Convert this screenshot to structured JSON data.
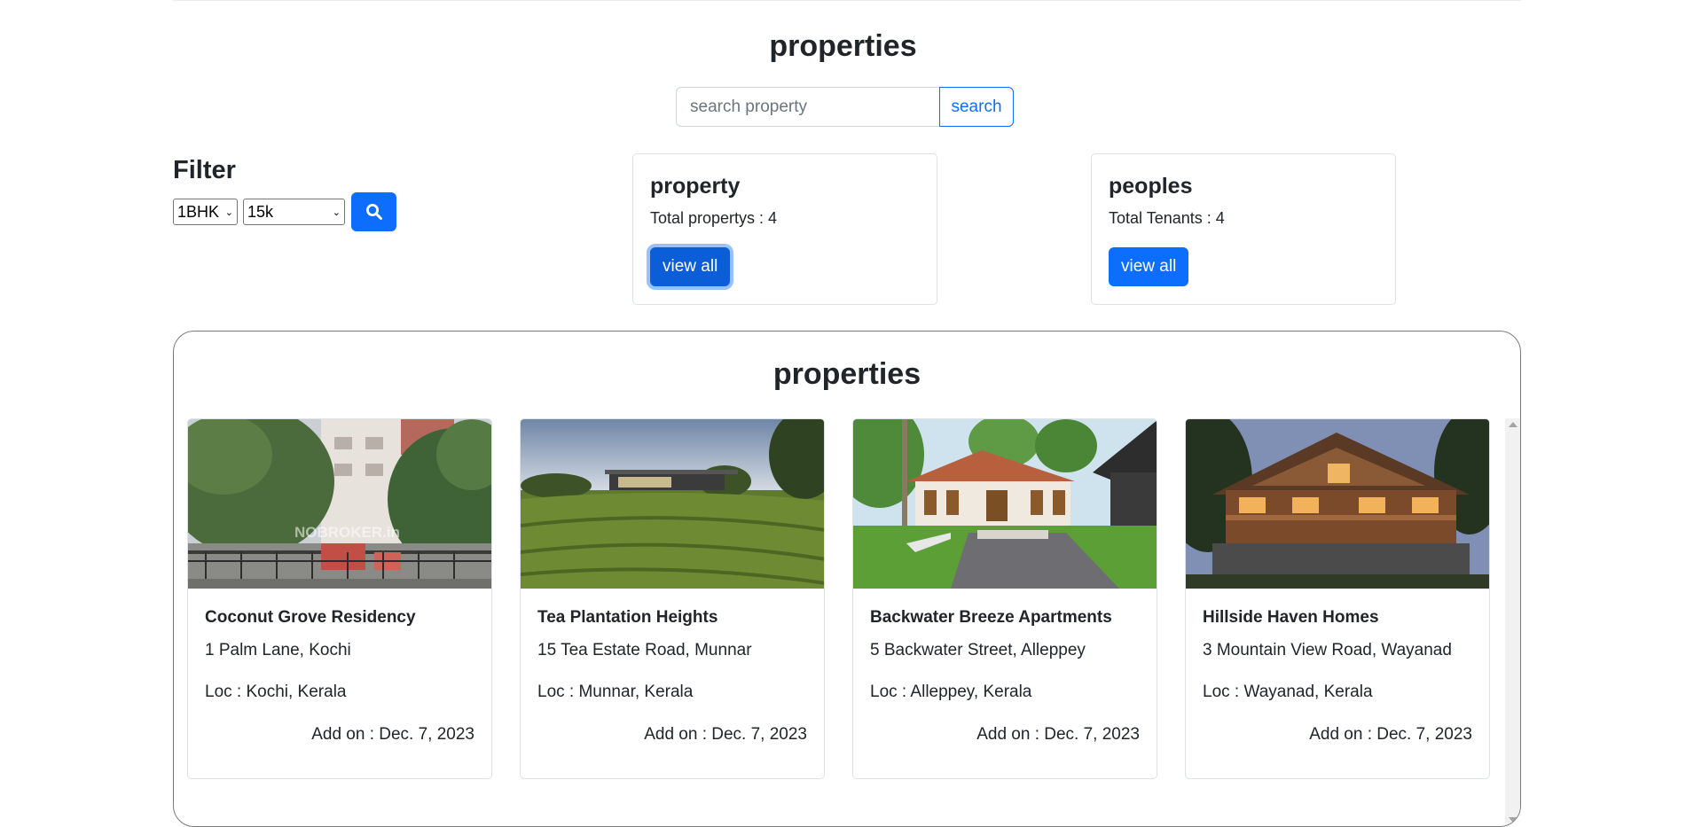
{
  "page_title": "properties",
  "search": {
    "placeholder": "search property",
    "button_label": "search"
  },
  "filter": {
    "title": "Filter",
    "bhk_value": "1BHK",
    "price_value": "15k"
  },
  "stats": [
    {
      "title": "property",
      "text": "Total propertys : 4",
      "button_label": "view all"
    },
    {
      "title": "peoples",
      "text": "Total Tenants : 4",
      "button_label": "view all"
    }
  ],
  "listing": {
    "title": "properties",
    "cards": [
      {
        "name": "Coconut Grove Residency",
        "address": "1 Palm Lane, Kochi",
        "location": "Loc : Kochi, Kerala",
        "added": "Add on : Dec. 7, 2023",
        "watermark": "NOBROKER.in"
      },
      {
        "name": "Tea Plantation Heights",
        "address": "15 Tea Estate Road, Munnar",
        "location": "Loc : Munnar, Kerala",
        "added": "Add on : Dec. 7, 2023"
      },
      {
        "name": "Backwater Breeze Apartments",
        "address": "5 Backwater Street, Alleppey",
        "location": "Loc : Alleppey, Kerala",
        "added": "Add on : Dec. 7, 2023"
      },
      {
        "name": "Hillside Haven Homes",
        "address": "3 Mountain View Road, Wayanad",
        "location": "Loc : Wayanad, Kerala",
        "added": "Add on : Dec. 7, 2023"
      }
    ]
  },
  "colors": {
    "primary": "#0d6efd",
    "text": "#212529",
    "border": "#dee2e6"
  }
}
